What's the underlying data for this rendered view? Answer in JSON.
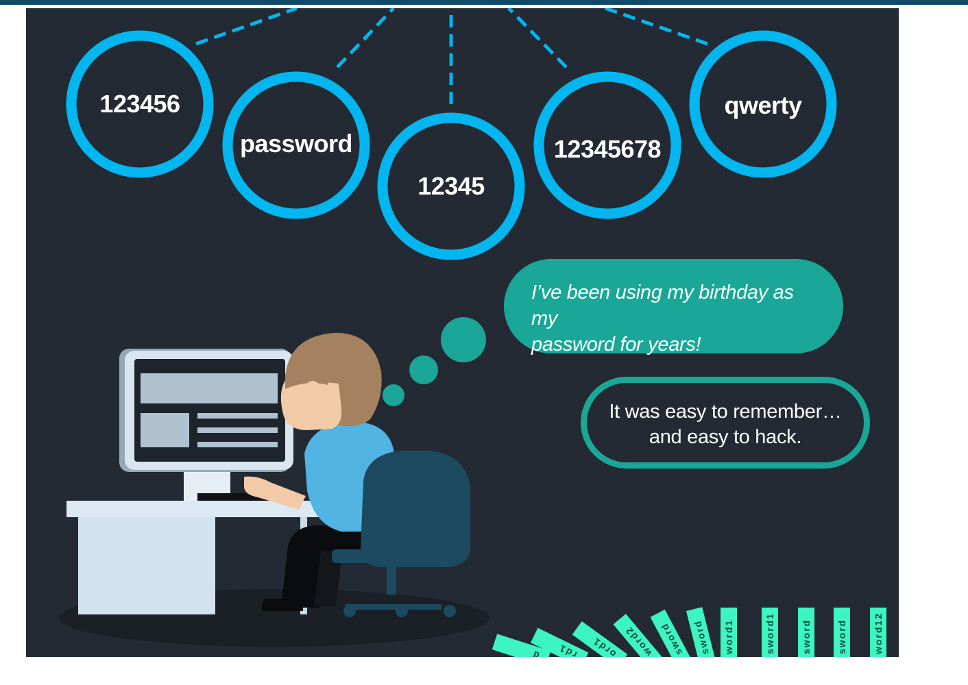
{
  "passwords": [
    {
      "label": "123456"
    },
    {
      "label": "password"
    },
    {
      "label": "12345"
    },
    {
      "label": "12345678"
    },
    {
      "label": "qwerty"
    }
  ],
  "thought_bubble": {
    "line1": "I’ve been using my birthday as my",
    "line2": "password for years!"
  },
  "caption_bubble": {
    "line1": "It was easy to remember…",
    "line2": "and easy to hack."
  },
  "dominoes": [
    {
      "label": "d"
    },
    {
      "label": "rd1"
    },
    {
      "label": "ord1"
    },
    {
      "label": "word2"
    },
    {
      "label": "sword"
    },
    {
      "label": "sword"
    },
    {
      "label": "word1"
    },
    {
      "label": "sword1"
    },
    {
      "label": "sword"
    },
    {
      "label": "sword"
    },
    {
      "label": "word12"
    }
  ],
  "colors": {
    "ring": "#03b6ef",
    "teal": "#1aa797",
    "domino": "#3df5c0",
    "panel": "#232a33"
  }
}
